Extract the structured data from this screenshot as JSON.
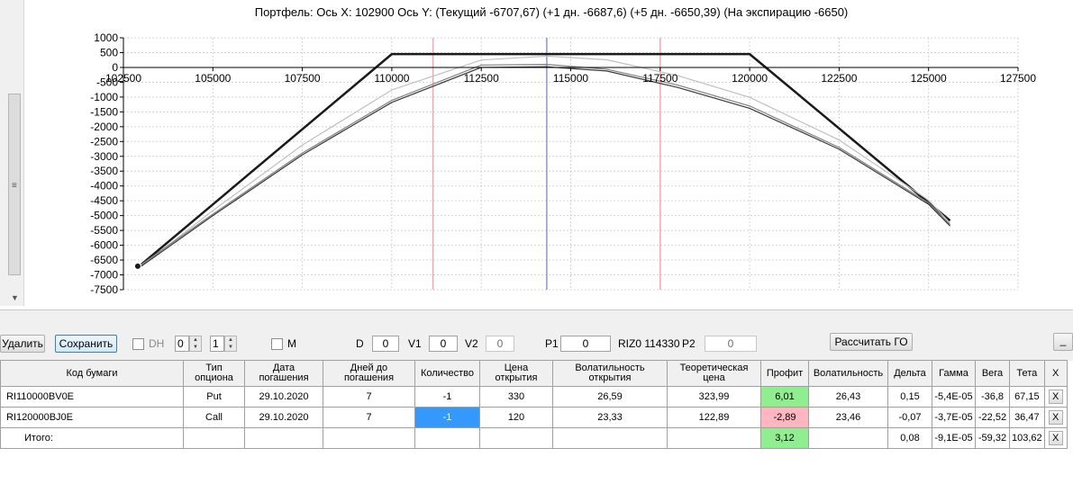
{
  "chart": {
    "title": "Портфель: Ось X: 102900 Ось Y:  (Текущий -6707,67)  (+1 дн. -6687,6)  (+5 дн. -6650,39)  (На экспирацию -6650)"
  },
  "chart_data": {
    "type": "line",
    "xlim": [
      102500,
      127500
    ],
    "ylim": [
      -7500,
      1000
    ],
    "x_ticks": [
      102500,
      105000,
      107500,
      110000,
      112500,
      115000,
      117500,
      120000,
      122500,
      125000,
      127500
    ],
    "y_ticks": [
      1000,
      500,
      0,
      -500,
      -1000,
      -1500,
      -2000,
      -2500,
      -3000,
      -3500,
      -4000,
      -4500,
      -5000,
      -5500,
      -6000,
      -6500,
      -7000,
      -7500
    ],
    "grid": true,
    "vertical_lines": [
      {
        "x": 111150,
        "color": "#f4a7b3"
      },
      {
        "x": 114330,
        "color": "#8c96c8"
      },
      {
        "x": 117500,
        "color": "#f4a7b3"
      }
    ],
    "series": [
      {
        "color": "#1a1a1a",
        "width": 2.5,
        "x": [
          103000,
          110000,
          120000,
          125600
        ],
        "y": [
          -6650,
          450,
          450,
          -5170
        ]
      },
      {
        "color": "#c0c0c0",
        "width": 1.2,
        "x": [
          103000,
          105000,
          107500,
          110000,
          112500,
          114330,
          116000,
          118000,
          120000,
          122500,
          125000,
          125600
        ],
        "y": [
          -6700,
          -4830,
          -2620,
          -760,
          250,
          380,
          260,
          -280,
          -1010,
          -2450,
          -4480,
          -5250
        ]
      },
      {
        "color": "#808080",
        "width": 1.2,
        "x": [
          103000,
          105000,
          107500,
          110000,
          112500,
          114330,
          116000,
          118000,
          120000,
          122500,
          125000,
          125600
        ],
        "y": [
          -6650,
          -4950,
          -2890,
          -1110,
          80,
          100,
          -60,
          -600,
          -1300,
          -2700,
          -4570,
          -5300
        ]
      },
      {
        "color": "#3a3a3a",
        "width": 1.2,
        "x": [
          103000,
          105000,
          107500,
          110000,
          112500,
          114330,
          116000,
          118000,
          120000,
          122500,
          125000,
          125600
        ],
        "y": [
          -6707,
          -5000,
          -2950,
          -1180,
          0,
          20,
          -120,
          -680,
          -1380,
          -2760,
          -4620,
          -5350
        ]
      }
    ],
    "marker": {
      "x": 102900,
      "y": -6707.67
    }
  },
  "toolbar": {
    "delete_label": "Удалить",
    "save_label": "Сохранить",
    "dh_label": "DH",
    "spin1_value": "0",
    "spin2_value": "1",
    "m_label": "M",
    "d_label": "D",
    "d_value": "0",
    "v1_label": "V1",
    "v1_value": "0",
    "v2_label": "V2",
    "v2_value": "0",
    "p1_label": "P1",
    "p1_value": "0",
    "riz_label": "RIZ0 114330",
    "p2_label": "P2",
    "p2_value": "0",
    "calc_label": "Рассчитать ГО",
    "minimize_label": "_"
  },
  "grid": {
    "headers": [
      "Код бумаги",
      "Тип опциона",
      "Дата погашения",
      "Дней до погашения",
      "Количество",
      "Цена открытия",
      "Волатильность открытия",
      "Теоретическая цена",
      "Профит",
      "Волатильность",
      "Дельта",
      "Гамма",
      "Вега",
      "Тета",
      "X"
    ],
    "rows": [
      [
        "RI110000BV0E",
        "Put",
        "29.10.2020",
        "7",
        "-1",
        "330",
        "26,59",
        "323,99",
        "6,01",
        "26,43",
        "0,15",
        "-5,4E-05",
        "-36,8",
        "67,15",
        "X"
      ],
      [
        "RI120000BJ0E",
        "Call",
        "29.10.2020",
        "7",
        "-1",
        "120",
        "23,33",
        "122,89",
        "-2,89",
        "23,46",
        "-0,07",
        "-3,7E-05",
        "-22,52",
        "36,47",
        "X"
      ],
      [
        "Итого:",
        "",
        "",
        "",
        "",
        "",
        "",
        "",
        "3,12",
        "",
        "0,08",
        "-9,1E-05",
        "-59,32",
        "103,62",
        "X"
      ]
    ]
  }
}
